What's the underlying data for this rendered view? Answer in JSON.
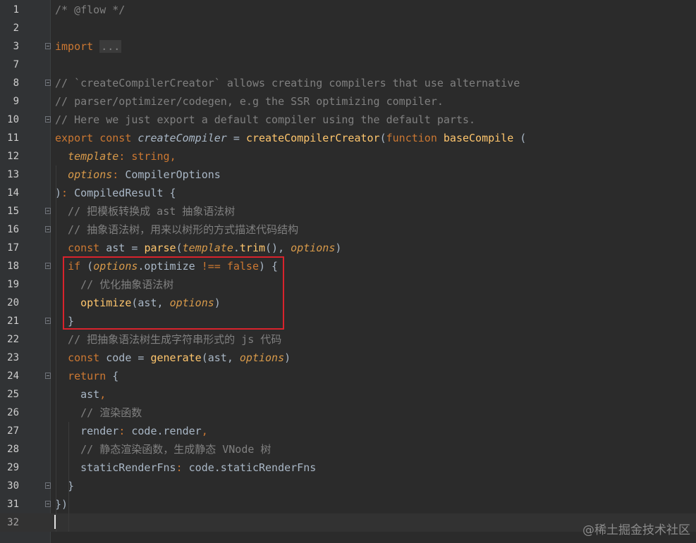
{
  "editor": {
    "lines": [
      {
        "n": "1",
        "tokens": [
          {
            "t": "/* @flow */",
            "c": "comment"
          }
        ]
      },
      {
        "n": "2",
        "tokens": []
      },
      {
        "n": "3",
        "tokens": [
          {
            "t": "import",
            "c": "kw"
          },
          {
            "t": " ",
            "c": "id"
          },
          {
            "t": "...",
            "c": "fold-text"
          }
        ]
      },
      {
        "n": "7",
        "tokens": []
      },
      {
        "n": "8",
        "tokens": [
          {
            "t": "// `createCompilerCreator` allows creating compilers that use alternative",
            "c": "comment"
          }
        ]
      },
      {
        "n": "9",
        "tokens": [
          {
            "t": "// parser/optimizer/codegen, e.g the SSR optimizing compiler.",
            "c": "comment"
          }
        ]
      },
      {
        "n": "10",
        "tokens": [
          {
            "t": "// Here we just export a default compiler using the default parts.",
            "c": "comment"
          }
        ]
      },
      {
        "n": "11",
        "tokens": [
          {
            "t": "export const ",
            "c": "kw"
          },
          {
            "t": "createCompiler",
            "c": "id-italic"
          },
          {
            "t": " = ",
            "c": "id"
          },
          {
            "t": "createCompilerCreator",
            "c": "fn"
          },
          {
            "t": "(",
            "c": "id"
          },
          {
            "t": "function ",
            "c": "kw"
          },
          {
            "t": "baseCompile",
            "c": "fn"
          },
          {
            "t": " (",
            "c": "id"
          }
        ]
      },
      {
        "n": "12",
        "tokens": [
          {
            "t": "  ",
            "c": "id"
          },
          {
            "t": "template",
            "c": "param"
          },
          {
            "t": ": ",
            "c": "kw"
          },
          {
            "t": "string",
            "c": "kw"
          },
          {
            "t": ",",
            "c": "kw"
          }
        ]
      },
      {
        "n": "13",
        "tokens": [
          {
            "t": "  ",
            "c": "id"
          },
          {
            "t": "options",
            "c": "param"
          },
          {
            "t": ": ",
            "c": "kw"
          },
          {
            "t": "CompilerOptions",
            "c": "id"
          }
        ]
      },
      {
        "n": "14",
        "tokens": [
          {
            "t": ")",
            "c": "id"
          },
          {
            "t": ": ",
            "c": "kw"
          },
          {
            "t": "CompiledResult {",
            "c": "id"
          }
        ]
      },
      {
        "n": "15",
        "tokens": [
          {
            "t": "  // 把模板转换成 ast 抽象语法树",
            "c": "comment"
          }
        ]
      },
      {
        "n": "16",
        "tokens": [
          {
            "t": "  // 抽象语法树，用来以树形的方式描述代码结构",
            "c": "comment"
          }
        ]
      },
      {
        "n": "17",
        "tokens": [
          {
            "t": "  ",
            "c": "id"
          },
          {
            "t": "const ",
            "c": "kw"
          },
          {
            "t": "ast = ",
            "c": "id"
          },
          {
            "t": "parse",
            "c": "fn"
          },
          {
            "t": "(",
            "c": "id"
          },
          {
            "t": "template",
            "c": "param"
          },
          {
            "t": ".",
            "c": "id"
          },
          {
            "t": "trim",
            "c": "fn"
          },
          {
            "t": "(), ",
            "c": "id"
          },
          {
            "t": "options",
            "c": "param"
          },
          {
            "t": ")",
            "c": "id"
          }
        ]
      },
      {
        "n": "18",
        "tokens": [
          {
            "t": "  ",
            "c": "id"
          },
          {
            "t": "if ",
            "c": "kw"
          },
          {
            "t": "(",
            "c": "id"
          },
          {
            "t": "options",
            "c": "param"
          },
          {
            "t": ".optimize ",
            "c": "id"
          },
          {
            "t": "!== false",
            "c": "kw"
          },
          {
            "t": ") {",
            "c": "id"
          }
        ]
      },
      {
        "n": "19",
        "tokens": [
          {
            "t": "    // 优化抽象语法树",
            "c": "comment"
          }
        ]
      },
      {
        "n": "20",
        "tokens": [
          {
            "t": "    ",
            "c": "id"
          },
          {
            "t": "optimize",
            "c": "fn"
          },
          {
            "t": "(ast, ",
            "c": "id"
          },
          {
            "t": "options",
            "c": "param"
          },
          {
            "t": ")",
            "c": "id"
          }
        ]
      },
      {
        "n": "21",
        "tokens": [
          {
            "t": "  }",
            "c": "id"
          }
        ]
      },
      {
        "n": "22",
        "tokens": [
          {
            "t": "  // 把抽象语法树生成字符串形式的 js 代码",
            "c": "comment"
          }
        ]
      },
      {
        "n": "23",
        "tokens": [
          {
            "t": "  ",
            "c": "id"
          },
          {
            "t": "const ",
            "c": "kw"
          },
          {
            "t": "code = ",
            "c": "id"
          },
          {
            "t": "generate",
            "c": "fn"
          },
          {
            "t": "(ast, ",
            "c": "id"
          },
          {
            "t": "options",
            "c": "param"
          },
          {
            "t": ")",
            "c": "id"
          }
        ]
      },
      {
        "n": "24",
        "tokens": [
          {
            "t": "  ",
            "c": "id"
          },
          {
            "t": "return ",
            "c": "kw"
          },
          {
            "t": "{",
            "c": "id"
          }
        ]
      },
      {
        "n": "25",
        "tokens": [
          {
            "t": "    ast",
            "c": "id"
          },
          {
            "t": ",",
            "c": "kw"
          }
        ]
      },
      {
        "n": "26",
        "tokens": [
          {
            "t": "    // 渲染函数",
            "c": "comment"
          }
        ]
      },
      {
        "n": "27",
        "tokens": [
          {
            "t": "    render",
            "c": "id"
          },
          {
            "t": ": ",
            "c": "kw"
          },
          {
            "t": "code.render",
            "c": "id"
          },
          {
            "t": ",",
            "c": "kw"
          }
        ]
      },
      {
        "n": "28",
        "tokens": [
          {
            "t": "    // 静态渲染函数，生成静态 VNode 树",
            "c": "comment"
          }
        ]
      },
      {
        "n": "29",
        "tokens": [
          {
            "t": "    staticRenderFns",
            "c": "id"
          },
          {
            "t": ": ",
            "c": "kw"
          },
          {
            "t": "code.staticRenderFns",
            "c": "id"
          }
        ]
      },
      {
        "n": "30",
        "tokens": [
          {
            "t": "  }",
            "c": "id"
          }
        ]
      },
      {
        "n": "31",
        "tokens": [
          {
            "t": "})",
            "c": "id"
          }
        ]
      },
      {
        "n": "32",
        "tokens": []
      }
    ],
    "current_line": "32",
    "fold_markers": [
      "3",
      "8",
      "10",
      "15",
      "16",
      "18",
      "21",
      "24",
      "30",
      "31"
    ]
  },
  "colors": {
    "background": "#2b2b2b",
    "keyword": "#cc7832",
    "function": "#ffc66d",
    "parameter": "#d89a4a",
    "comment": "#808080",
    "text": "#a9b7c6",
    "highlight_box": "#d9232c"
  },
  "watermark": "@稀土掘金技术社区"
}
